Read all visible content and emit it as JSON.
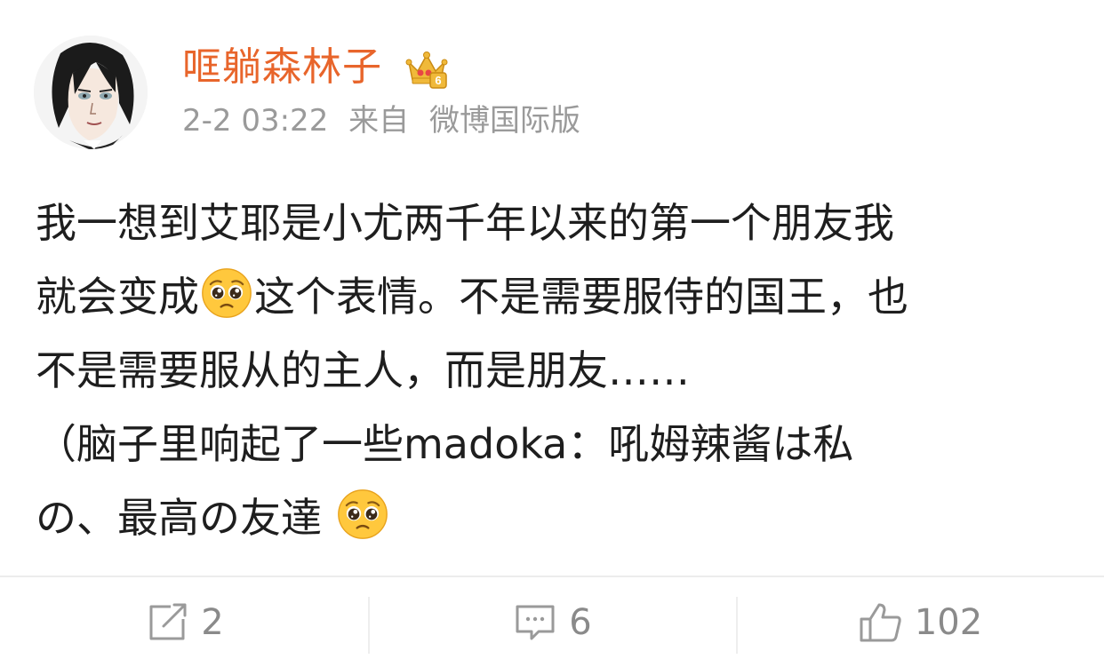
{
  "post": {
    "username": "哐躺森林子",
    "time": "2-2 03:22",
    "source_prefix": "来自",
    "source": "微博国际版",
    "lines": [
      {
        "before": "我一想到艾耶是小尤两千年以来的第一个朋友我"
      },
      {
        "before": "就会变成",
        "emoji": "pleading-face",
        "after": "这个表情。不是需要服侍的国王，也"
      },
      {
        "before": "不是需要服从的主人，而是朋友……"
      },
      {
        "before": "（脑子里响起了一些madoka：吼姆辣酱は私"
      },
      {
        "before": "の、最高の友達 ",
        "emoji": "pleading-face"
      }
    ]
  },
  "actions": {
    "repost_count": "2",
    "comment_count": "6",
    "like_count": "102"
  },
  "colors": {
    "username": "#e8652b",
    "meta": "#9a9a9a",
    "icon": "#999999",
    "emoji_face": "#ffc83d"
  }
}
